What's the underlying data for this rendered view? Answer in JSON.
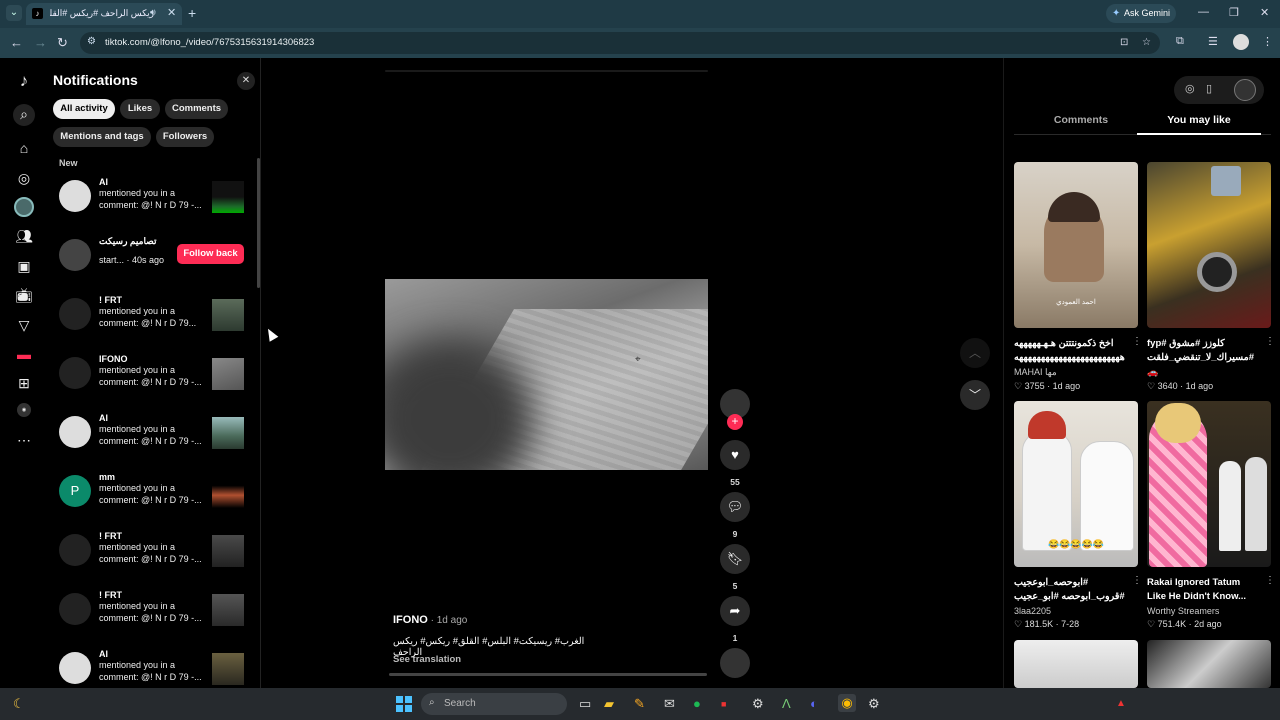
{
  "browser": {
    "tab_title": "ريكس الراحف #ريكس #القلق",
    "url": "tiktok.com/@lfono_/video/7675315631914306823",
    "ask_gemini": "Ask Gemini",
    "icons": [
      "back-arrow",
      "forward-arrow",
      "reload",
      "site-info",
      "install-app",
      "star",
      "extensions",
      "media",
      "profile",
      "menu"
    ]
  },
  "rail": {
    "icons": [
      "tiktok-logo",
      "search",
      "home",
      "explore",
      "following-avatar",
      "friends",
      "live",
      "live-tv",
      "messages",
      "inbox",
      "upload",
      "profile",
      "more"
    ]
  },
  "notifications": {
    "title": "Notifications",
    "filters": [
      "All activity",
      "Likes",
      "Comments",
      "Mentions and tags",
      "Followers"
    ],
    "active_filter": "All activity",
    "section": "New",
    "items": [
      {
        "name": "Al",
        "text": "mentioned you in a comment: @! N r D 79 -...",
        "kind": "thumb"
      },
      {
        "name": "تصاميم رسيكت",
        "text": "start... · 40s ago",
        "kind": "follow",
        "button": "Follow back"
      },
      {
        "name": "! FRT",
        "text": "mentioned you in a comment: @! N r D 79...",
        "kind": "thumb"
      },
      {
        "name": "IFONO",
        "text": "mentioned you in a comment: @! N r D 79 -...",
        "kind": "thumb"
      },
      {
        "name": "Al",
        "text": "mentioned you in a comment: @! N r D 79 -...",
        "kind": "thumb"
      },
      {
        "name": "mm",
        "text": "mentioned you in a comment: @! N r D 79 -...",
        "kind": "thumb",
        "initial": "P"
      },
      {
        "name": "! FRT",
        "text": "mentioned you in a comment: @! N r D 79 -...",
        "kind": "thumb"
      },
      {
        "name": "! FRT",
        "text": "mentioned you in a comment: @! N r D 79 -...",
        "kind": "thumb"
      },
      {
        "name": "Al",
        "text": "mentioned you in a comment: @! N r D 79 -...",
        "kind": "thumb"
      }
    ]
  },
  "video": {
    "author": "IFONO",
    "time": " · 1d ago",
    "caption": "الغرب# ريسيكت# البلس# القلق# ريكس# ريكس الراحف",
    "see_translation": "See translation",
    "likes": "55",
    "comments": "9",
    "saves": "5",
    "shares": "1"
  },
  "right_panel": {
    "tabs": [
      "Comments",
      "You may like"
    ],
    "active_tab": "You may like",
    "cards": [
      {
        "caption1": "اخخ ذكمونتتتن هـهـهههههه",
        "caption2": "ههههههههههههههههههههههههه",
        "author": "MAHAI مها",
        "likes": "3755",
        "age": "1d ago",
        "overlay": "احمد العمودي"
      },
      {
        "caption1": "كلوزز #مشوق #fyp",
        "caption2": "#مسيراك_لا_تنقضي_فلقت",
        "author": "🚗",
        "likes": "3640",
        "age": "1d ago"
      },
      {
        "caption1": "#ابوحصه_ابوعجيب",
        "caption2": "#قروب_ابوحصه #ابو_عجيب",
        "author": "3laa2205",
        "likes": "181.5K",
        "age": "7-28",
        "overlay": "😂😂😂😂😂"
      },
      {
        "caption1": "Rakai Ignored Tatum",
        "caption2": "Like He Didn't Know...",
        "author": "Worthy Streamers",
        "likes": "751.4K",
        "age": "2d ago"
      }
    ]
  },
  "taskbar": {
    "search_placeholder": "Search"
  }
}
